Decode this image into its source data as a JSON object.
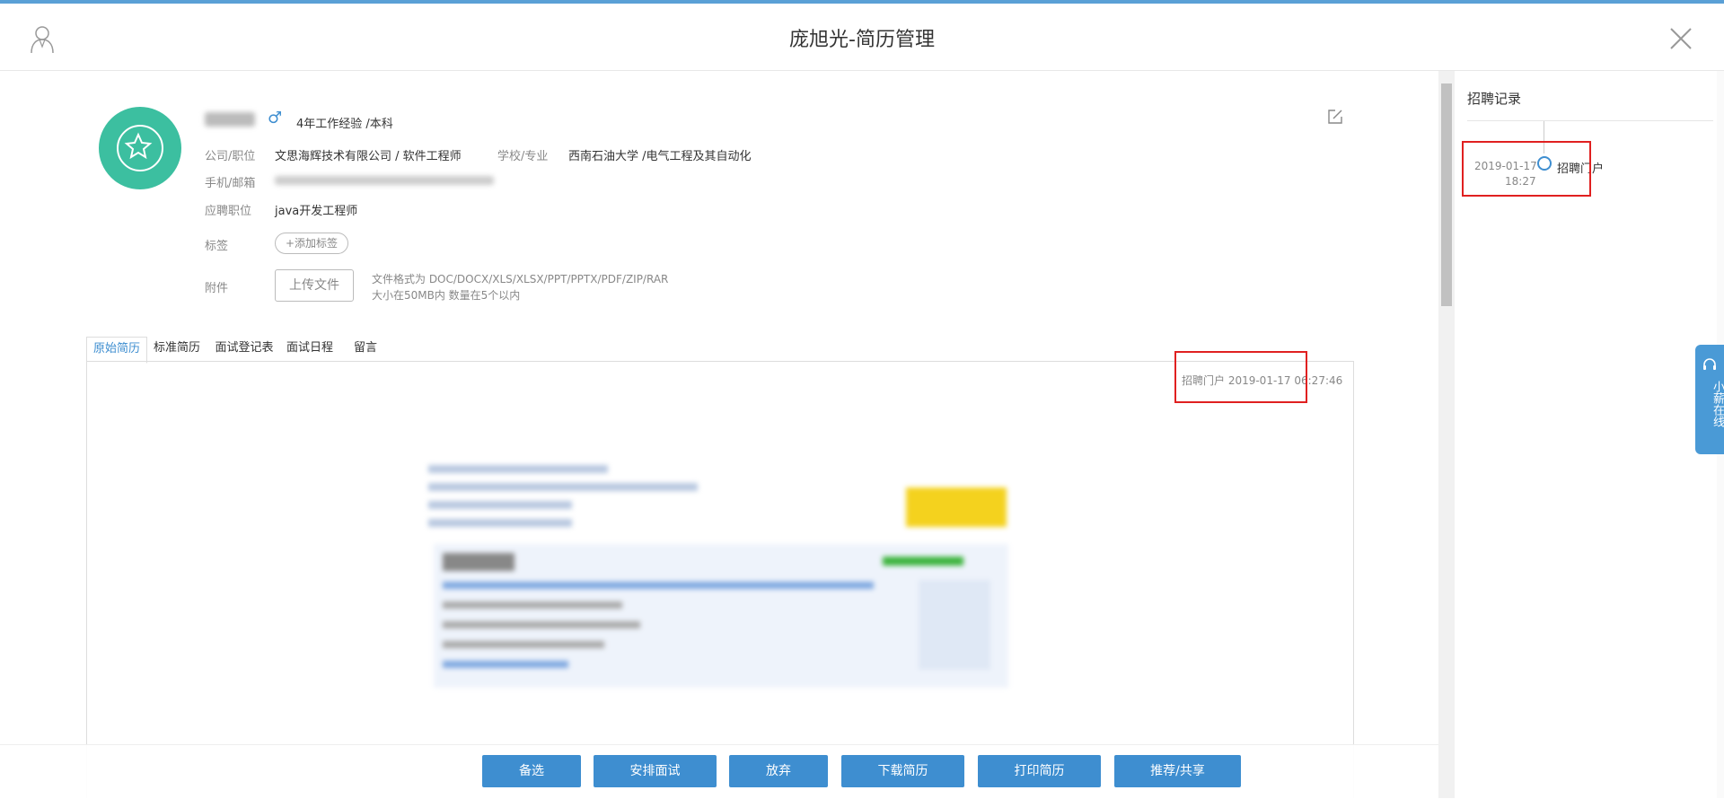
{
  "header": {
    "title": "庞旭光-简历管理",
    "user_icon": "user-icon",
    "close_icon": "close-icon"
  },
  "candidate": {
    "experience": "4年工作经验 /本科",
    "gender_symbol": "♂",
    "company_label": "公司/职位",
    "company_value": "文思海辉技术有限公司 / 软件工程师",
    "school_label": "学校/专业",
    "school_value": "西南石油大学 /电气工程及其自动化",
    "contact_label": "手机/邮箱",
    "position_label": "应聘职位",
    "position_value": "java开发工程师",
    "tags_label": "标签",
    "add_tag_label": "+添加标签",
    "attachment_label": "附件",
    "upload_label": "上传文件",
    "format_hint": "文件格式为 DOC/DOCX/XLS/XLSX/PPT/PPTX/PDF/ZIP/RAR",
    "size_hint": "大小在50MB内 数量在5个以内"
  },
  "tabs": [
    "原始简历",
    "标准简历",
    "面试登记表",
    "面试日程",
    "留言"
  ],
  "resume": {
    "source_stamp": "招聘门户 2019-01-17 06:27:46"
  },
  "sidebar": {
    "heading": "招聘记录",
    "records": [
      {
        "date": "2019-01-17",
        "time": "18:27",
        "source": "招聘门户"
      }
    ]
  },
  "chat_tab": {
    "label": "小薪在线",
    "icon": "headset-icon"
  },
  "actions": [
    "备选",
    "安排面试",
    "放弃",
    "下载简历",
    "打印简历",
    "推荐/共享"
  ],
  "colors": {
    "accent": "#3e8ed0",
    "avatar": "#3cbfa0",
    "highlight": "#e02020"
  }
}
